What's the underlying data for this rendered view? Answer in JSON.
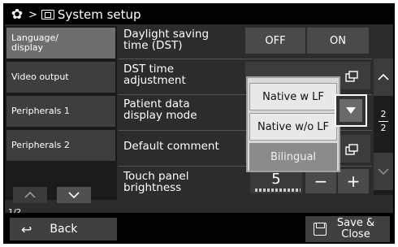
{
  "header": {
    "title": "System setup",
    "separator": ">",
    "icons": [
      "gear-icon",
      "monitor-icon"
    ]
  },
  "sidebar": {
    "items": [
      {
        "label": "Language/\ndisplay",
        "active": true
      },
      {
        "label": "Video output",
        "active": false
      },
      {
        "label": "Peripherals 1",
        "active": false
      },
      {
        "label": "Peripherals 2",
        "active": false
      }
    ],
    "page_indicator": "1/2"
  },
  "settings": {
    "dst": {
      "label": "Daylight saving\ntime (DST)",
      "off_label": "OFF",
      "on_label": "ON"
    },
    "dst_adjust": {
      "label": "DST time\nadjustment"
    },
    "patient_mode": {
      "label": "Patient data\ndisplay mode"
    },
    "default_comment": {
      "label": "Default comment"
    },
    "brightness": {
      "label": "Touch panel\nbrightness",
      "value": "5",
      "minus": "−",
      "plus": "+"
    }
  },
  "dropdown": {
    "options": [
      "Native w LF",
      "Native w/o LF",
      "Bilingual"
    ],
    "selected": "Bilingual"
  },
  "scroll": {
    "page_current": "2",
    "page_total": "2"
  },
  "footer": {
    "back_label": "Back",
    "save_label": "Save &\nClose"
  },
  "colors": {
    "background": "#2c2c2c",
    "active_tab": "#6e6e6e",
    "button": "#4a4a4a",
    "dropdown_selected": "#8b8b8b"
  }
}
